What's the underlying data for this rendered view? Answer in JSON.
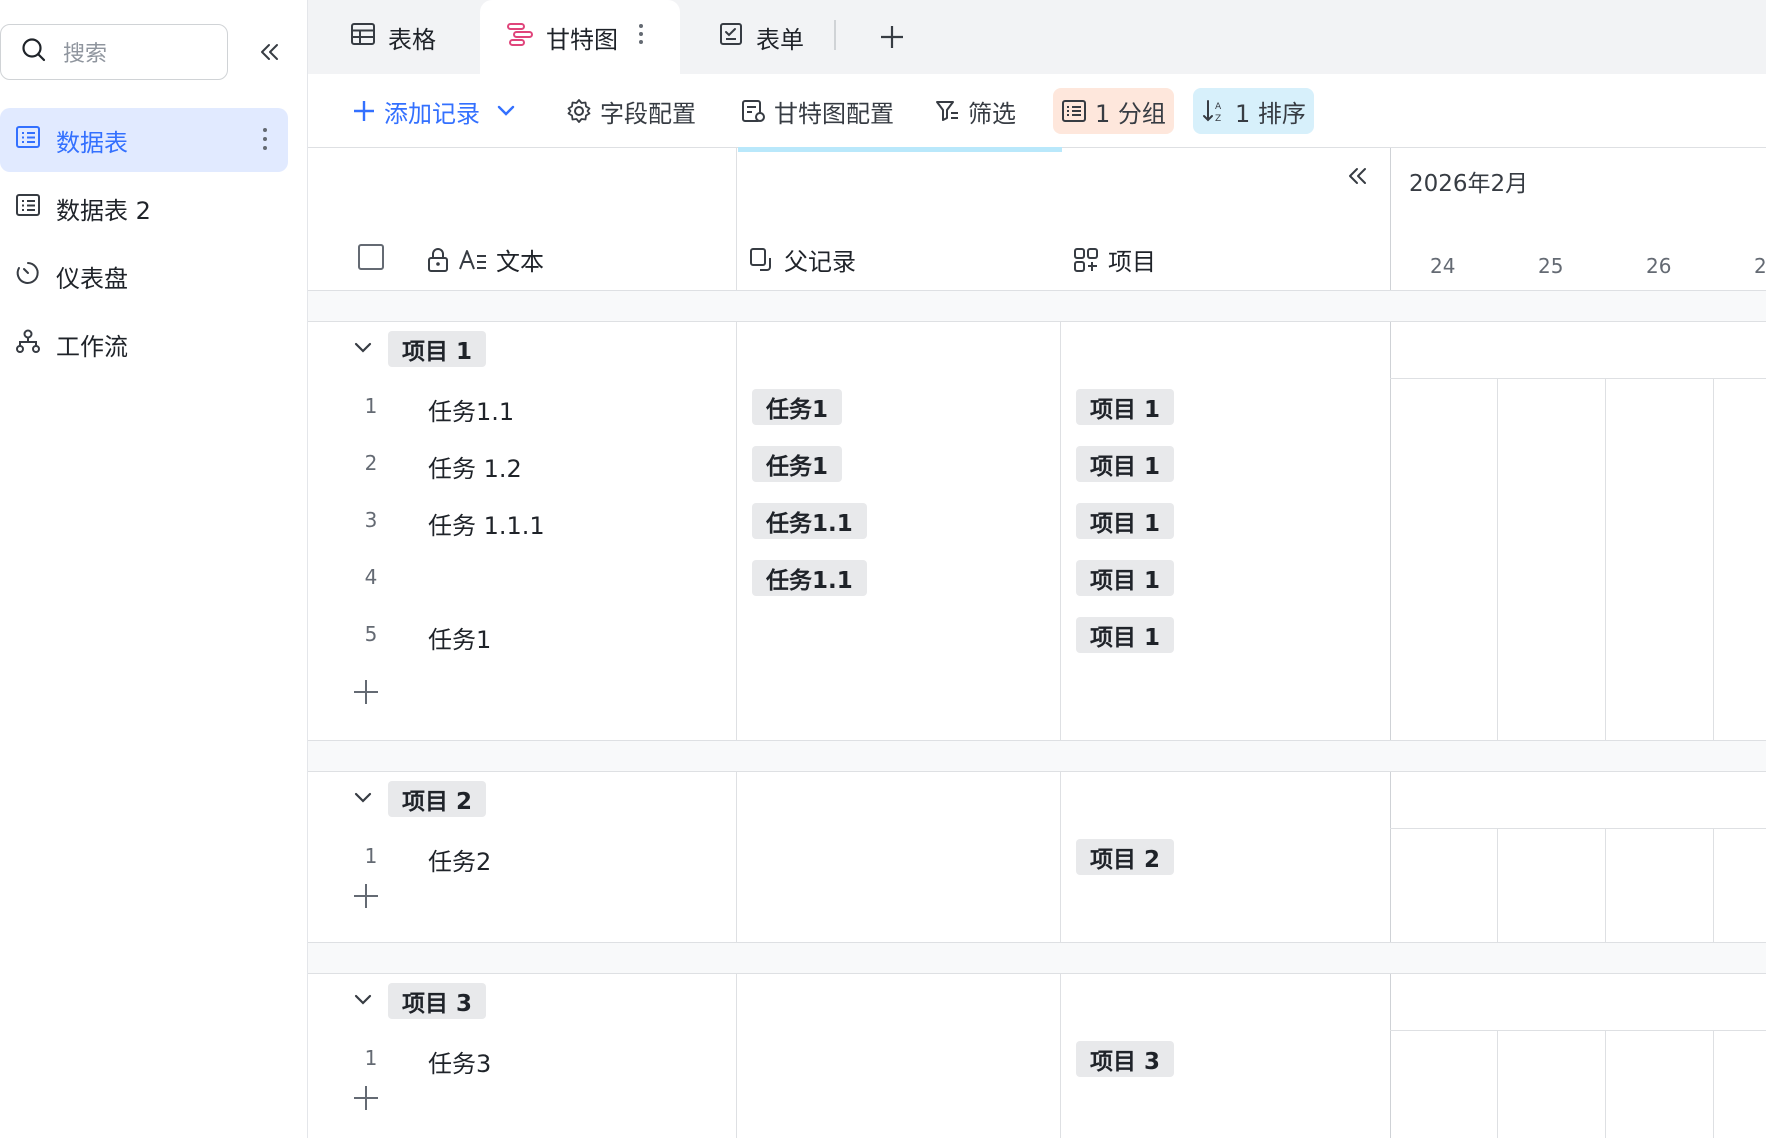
{
  "sidebar": {
    "search_placeholder": "搜索",
    "items": [
      {
        "label": "数据表",
        "icon": "table-icon",
        "active": true
      },
      {
        "label": "数据表 2",
        "icon": "table-icon"
      },
      {
        "label": "仪表盘",
        "icon": "dashboard-icon"
      },
      {
        "label": "工作流",
        "icon": "workflow-icon"
      }
    ]
  },
  "tabs": [
    {
      "label": "表格",
      "icon": "grid-view-icon"
    },
    {
      "label": "甘特图",
      "icon": "gantt-icon",
      "active": true
    },
    {
      "label": "表单",
      "icon": "form-icon"
    }
  ],
  "toolbar": {
    "add_record": "添加记录",
    "field_config": "字段配置",
    "gantt_config": "甘特图配置",
    "filter": "筛选",
    "group": "1 分组",
    "sort": "1 排序"
  },
  "columns": {
    "text": "文本",
    "parent": "父记录",
    "project": "项目"
  },
  "timeline": {
    "month": "2026年2月",
    "days": [
      "24",
      "25",
      "26",
      "2"
    ]
  },
  "groups": [
    {
      "name": "项目 1",
      "rows": [
        {
          "num": "1",
          "text": "任务1.1",
          "parent": "任务1",
          "project": "项目 1"
        },
        {
          "num": "2",
          "text": "任务 1.2",
          "parent": "任务1",
          "project": "项目 1"
        },
        {
          "num": "3",
          "text": "任务 1.1.1",
          "parent": "任务1.1",
          "project": "项目 1"
        },
        {
          "num": "4",
          "text": "",
          "parent": "任务1.1",
          "project": "项目 1"
        },
        {
          "num": "5",
          "text": "任务1",
          "parent": "",
          "project": "项目 1"
        }
      ]
    },
    {
      "name": "项目 2",
      "rows": [
        {
          "num": "1",
          "text": "任务2",
          "parent": "",
          "project": "项目 2"
        }
      ]
    },
    {
      "name": "项目 3",
      "rows": [
        {
          "num": "1",
          "text": "任务3",
          "parent": "",
          "project": "项目 3"
        }
      ]
    }
  ],
  "colors": {
    "accent": "#3370ff",
    "gantt_tab_icon": "#e0457b",
    "group_chip_bg": "#fee7dc",
    "sort_chip_bg": "#d7f0fb"
  }
}
